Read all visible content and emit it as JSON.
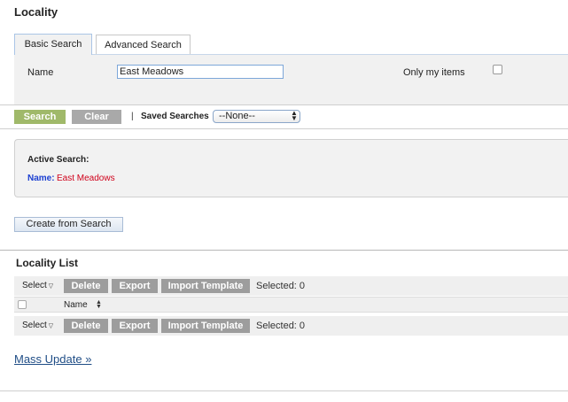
{
  "page": {
    "title": "Locality"
  },
  "tabs": {
    "basic": "Basic Search",
    "advanced": "Advanced Search"
  },
  "search": {
    "name_label": "Name",
    "name_value": "East Meadows",
    "only_my_items_label": "Only my items",
    "only_my_items_checked": false
  },
  "actions": {
    "search_label": "Search",
    "clear_label": "Clear",
    "separator": "|",
    "saved_searches_label": "Saved Searches",
    "saved_searches_value": "--None--"
  },
  "active_search": {
    "heading": "Active Search:",
    "key": "Name:",
    "value": "East Meadows"
  },
  "create_from_search_label": "Create from Search",
  "list": {
    "title": "Locality List",
    "select_label": "Select",
    "delete_label": "Delete",
    "export_label": "Export",
    "import_label": "Import Template",
    "selected_text": "Selected: 0",
    "column_name": "Name"
  },
  "mass_update_label": "Mass Update »",
  "colors": {
    "search_button": "#a0b96a",
    "gray_button": "#9d9d9d",
    "active_key": "#1b3fd1",
    "active_value": "#d0021b",
    "link": "#1f4d86"
  },
  "icons": [
    "chevron-down-icon",
    "select-arrows-icon",
    "sort-icon"
  ]
}
